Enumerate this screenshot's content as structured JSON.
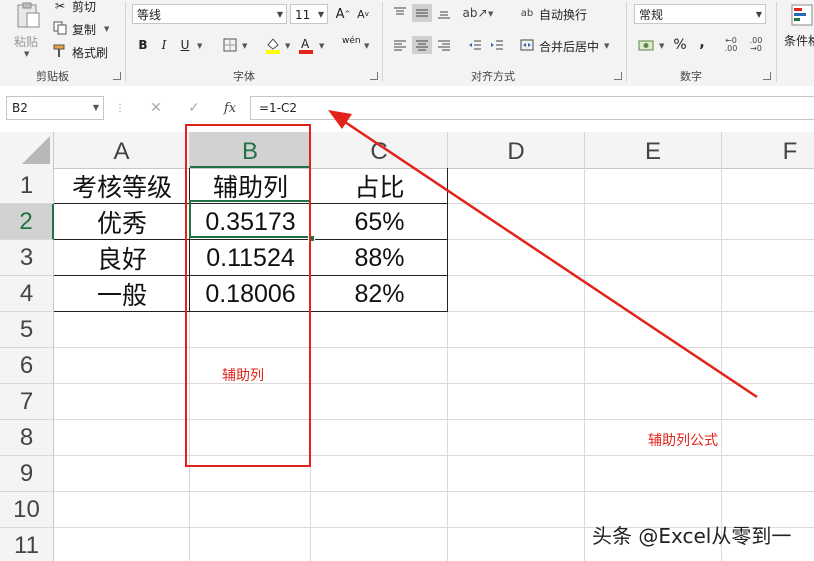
{
  "ribbon": {
    "clipboard": {
      "label": "剪贴板",
      "paste": "粘贴",
      "cut": "剪切",
      "copy": "复制",
      "format_painter": "格式刷"
    },
    "font": {
      "label": "字体",
      "font_name": "等线",
      "font_size": "11",
      "bold": "B",
      "italic": "I",
      "underline": "U",
      "phonetic": "wén"
    },
    "alignment": {
      "label": "对齐方式",
      "wrap_text": "自动换行",
      "merge_center": "合并后居中"
    },
    "number": {
      "label": "数字",
      "format": "常规",
      "percent": "%",
      "comma": ","
    },
    "styles": {
      "conditional_format": "条件格"
    }
  },
  "formula_bar": {
    "name_box": "B2",
    "formula": "=1-C2",
    "fx": "fx"
  },
  "grid": {
    "columns": [
      "A",
      "B",
      "C",
      "D",
      "E",
      "F"
    ],
    "rows": [
      "1",
      "2",
      "3",
      "4",
      "5",
      "6",
      "7",
      "8",
      "9",
      "10",
      "11"
    ],
    "table": [
      {
        "a": "考核等级",
        "b": "辅助列",
        "c": "占比"
      },
      {
        "a": "优秀",
        "b": "0.35173",
        "c": "65%"
      },
      {
        "a": "良好",
        "b": "0.11524",
        "c": "88%"
      },
      {
        "a": "一般",
        "b": "0.18006",
        "c": "82%"
      }
    ]
  },
  "annotations": {
    "helper_column": "辅助列",
    "helper_formula": "辅助列公式",
    "color": "#e2231a"
  },
  "watermark": "头条 @Excel从零到一",
  "colors": {
    "excel_green": "#217346",
    "ribbon_bg": "#f3f3f3"
  }
}
